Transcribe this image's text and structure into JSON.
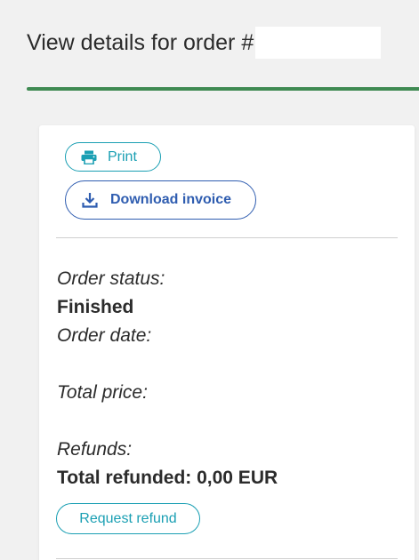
{
  "header": {
    "title": "View details for order #",
    "accent_color": "#3f8a52"
  },
  "actions": {
    "print_label": "Print",
    "print_icon": "printer-icon",
    "download_label": "Download invoice",
    "download_icon": "download-icon"
  },
  "order": {
    "status_label": "Order status:",
    "status_value": "Finished",
    "date_label": "Order date:",
    "date_value": "",
    "price_label": "Total price:",
    "price_value": "",
    "refunds_label": "Refunds:",
    "total_refunded": "Total refunded: 0,00 EUR"
  },
  "refund": {
    "request_label": "Request refund"
  },
  "colors": {
    "teal": "#1a9fb3",
    "blue": "#2f5db0",
    "background": "#f1f1f1"
  }
}
